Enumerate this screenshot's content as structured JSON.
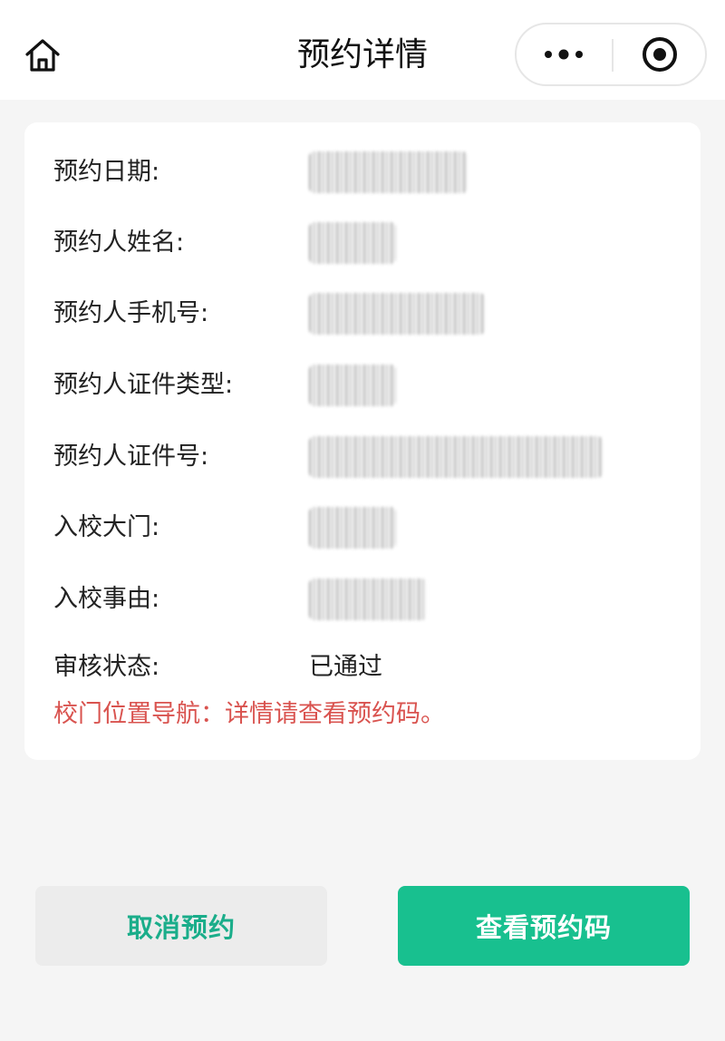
{
  "header": {
    "title": "预约详情",
    "home_icon": "home-icon",
    "more_icon": "more-dots-icon",
    "close_icon": "target-close-icon"
  },
  "details": {
    "rows": [
      {
        "label": "预约日期:",
        "value": ""
      },
      {
        "label": "预约人姓名:",
        "value": ""
      },
      {
        "label": "预约人手机号:",
        "value": ""
      },
      {
        "label": "预约人证件类型:",
        "value": ""
      },
      {
        "label": "预约人证件号:",
        "value": ""
      },
      {
        "label": "入校大门:",
        "value": ""
      },
      {
        "label": "入校事由:",
        "value": ""
      },
      {
        "label": "审核状态:",
        "value": "已通过"
      }
    ],
    "navigation_note": "校门位置导航：详情请查看预约码。"
  },
  "actions": {
    "cancel_label": "取消预约",
    "view_code_label": "查看预约码"
  },
  "colors": {
    "accent": "#18c08f",
    "warning_text": "#d9534f",
    "background": "#f5f5f5"
  }
}
